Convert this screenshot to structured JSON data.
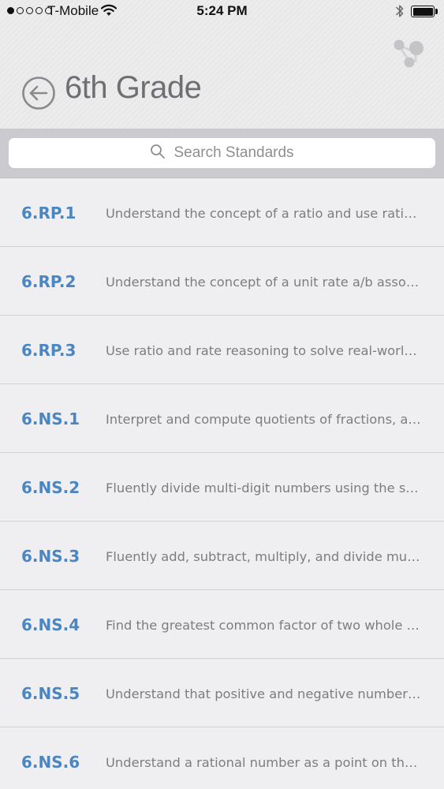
{
  "status_bar": {
    "carrier": "T-Mobile",
    "time": "5:24 PM",
    "signal_bars_filled": 1,
    "signal_bars_total": 5,
    "battery_level": 1.0
  },
  "header": {
    "title": "6th Grade",
    "back_icon": "back-arrow-circle-icon",
    "share_icon": "share-nodes-icon"
  },
  "search": {
    "placeholder": "Search Standards",
    "icon": "search-icon"
  },
  "colors": {
    "accent": "#4a86c2",
    "title": "#6f6f73",
    "description": "#7d7d80"
  },
  "standards": [
    {
      "code": "6.RP.1",
      "description": "Understand the concept of a ratio and use ratio l..."
    },
    {
      "code": "6.RP.2",
      "description": "Understand the concept of a unit rate a/b associ..."
    },
    {
      "code": "6.RP.3",
      "description": "Use ratio and rate reasoning to solve real-world a..."
    },
    {
      "code": "6.NS.1",
      "description": "Interpret and compute quotients of fractions, an..."
    },
    {
      "code": "6.NS.2",
      "description": "Fluently divide multi-digit numbers using the stan..."
    },
    {
      "code": "6.NS.3",
      "description": "Fluently add, subtract, multiply, and divide multi-..."
    },
    {
      "code": "6.NS.4",
      "description": "Find the greatest common factor of two whole n..."
    },
    {
      "code": "6.NS.5",
      "description": "Understand that positive and negative numbers..."
    },
    {
      "code": "6.NS.6",
      "description": "Understand a rational number as a point on the..."
    }
  ]
}
